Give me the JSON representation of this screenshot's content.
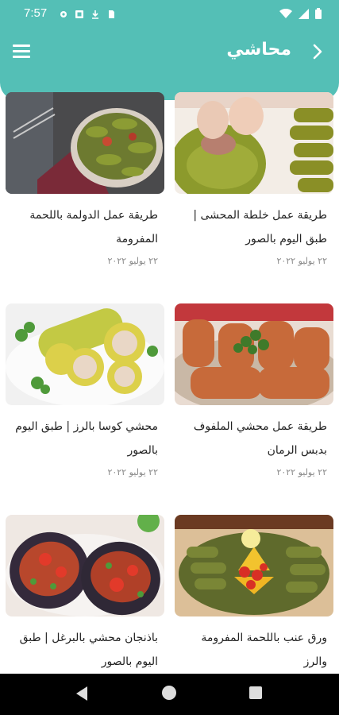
{
  "status_bar": {
    "time": "7:57"
  },
  "header": {
    "title": "محاشي"
  },
  "cards": [
    {
      "title": "طريقة عمل خلطة المحشى | طبق اليوم بالصور",
      "date": "٢٢ يوليو ٢٠٢٢"
    },
    {
      "title": "طريقة عمل الدولمة باللحمة المفرومة",
      "date": "٢٢ يوليو ٢٠٢٢"
    },
    {
      "title": "طريقة عمل محشي الملفوف بدبس الرمان",
      "date": "٢٢ يوليو ٢٠٢٢"
    },
    {
      "title": "محشي كوسا بالرز | طبق اليوم بالصور",
      "date": "٢٢ يوليو ٢٠٢٢"
    },
    {
      "title": "ورق عنب باللحمة المفرومة والرز",
      "date": ""
    },
    {
      "title": "باذنجان محشي بالبرغل | طبق اليوم بالصور",
      "date": ""
    }
  ]
}
